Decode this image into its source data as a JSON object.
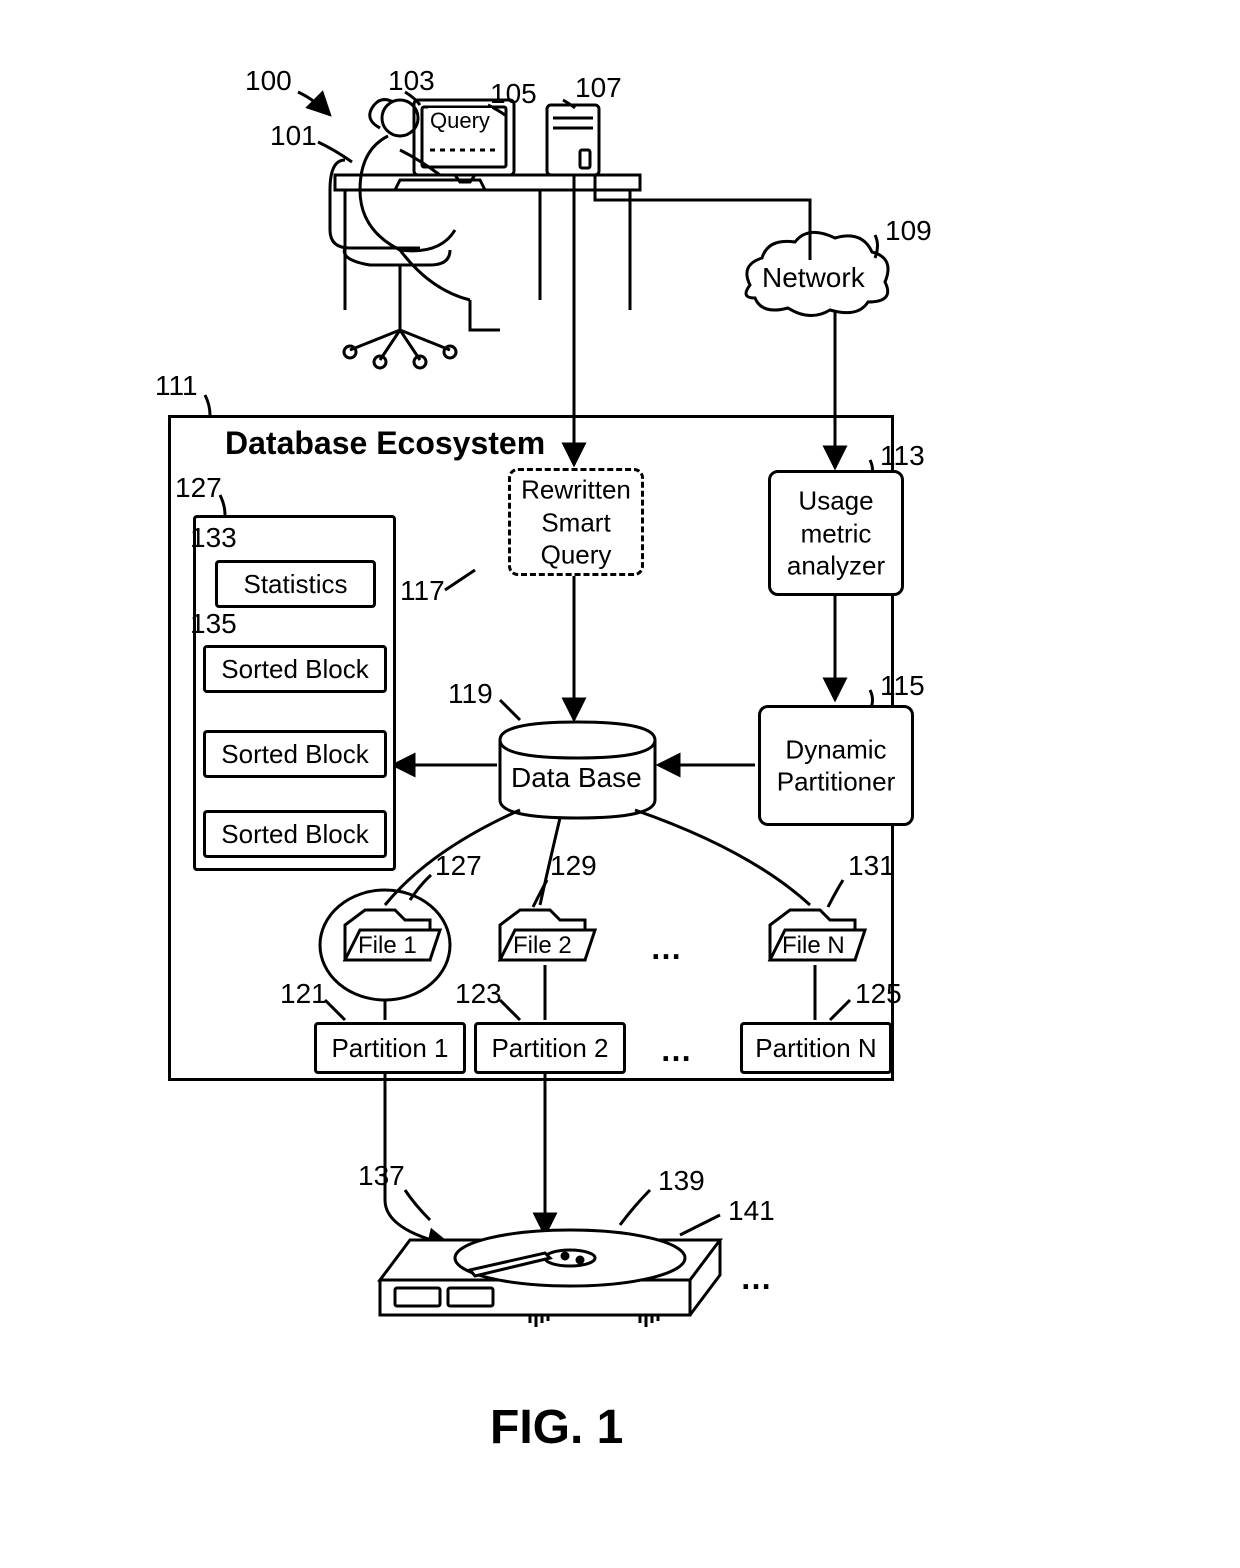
{
  "refs": {
    "r100": "100",
    "r101": "101",
    "r103": "103",
    "r105": "105",
    "r107": "107",
    "r109": "109",
    "r111": "111",
    "r113": "113",
    "r115": "115",
    "r117": "117",
    "r119": "119",
    "r121": "121",
    "r123": "123",
    "r125": "125",
    "r127a": "127",
    "r127b": "127",
    "r129": "129",
    "r131": "131",
    "r133": "133",
    "r135": "135",
    "r137": "137",
    "r139": "139",
    "r141": "141"
  },
  "query": "Query",
  "network": "Network",
  "ecosystem_title": "Database Ecosystem",
  "rewritten_smart_query": "Rewritten\nSmart\nQuery",
  "usage_metric_analyzer": "Usage\nmetric\nanalyzer",
  "dynamic_partitioner": "Dynamic\nPartitioner",
  "database": "Data Base",
  "statistics": "Statistics",
  "sorted_block": "Sorted  Block",
  "file1": "File 1",
  "file2": "File 2",
  "fileN": "File N",
  "partition1": "Partition 1",
  "partition2": "Partition 2",
  "partitionN": "Partition N",
  "ellipsis": "…",
  "figure": "FIG. 1"
}
